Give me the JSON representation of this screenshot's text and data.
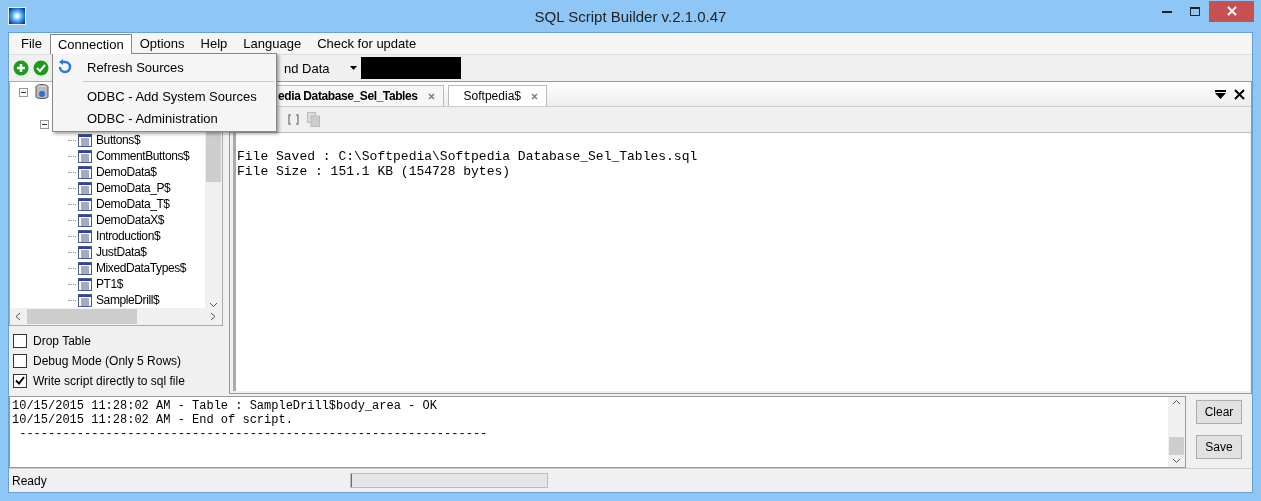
{
  "window": {
    "title": "SQL Script Builder v.2.1.0.47"
  },
  "menu": [
    {
      "label": "File",
      "selected": false
    },
    {
      "label": "Connection",
      "selected": true
    },
    {
      "label": "Options",
      "selected": false
    },
    {
      "label": "Help",
      "selected": false
    },
    {
      "label": "Language",
      "selected": false
    },
    {
      "label": "Check for update",
      "selected": false
    }
  ],
  "dropdown": [
    {
      "label": "Refresh Sources",
      "kind": "icon"
    },
    {
      "kind": "separator"
    },
    {
      "label": "ODBC - Add System Sources",
      "kind": "plain"
    },
    {
      "label": "ODBC - Administration",
      "kind": "plain"
    }
  ],
  "toolbar": {
    "combo_value": "nd Data"
  },
  "tree": {
    "items": [
      "Buttons$",
      "CommentButtons$",
      "DemoData$",
      "DemoData_P$",
      "DemoData_T$",
      "DemoDataX$",
      "Introduction$",
      "JustData$",
      "MixedDataTypes$",
      "PT1$",
      "SampleDrill$"
    ]
  },
  "options": [
    {
      "label": "Drop Table",
      "checked": false
    },
    {
      "label": "Debug Mode (Only 5 Rows)",
      "checked": false
    },
    {
      "label": "Write script directly to sql file",
      "checked": true
    }
  ],
  "tabs": [
    {
      "label": "edia Database_Sel_Tables",
      "selected": true
    },
    {
      "label": "Softpedia$",
      "selected": false
    }
  ],
  "editor": {
    "lines": [
      "File Saved : C:\\Softpedia\\Softpedia Database_Sel_Tables.sql",
      "File Size : 151.1 KB (154728 bytes)"
    ]
  },
  "log": {
    "lines": [
      "10/15/2015 11:28:02 AM - Table : SampleDrill$body_area - OK",
      "10/15/2015 11:28:02 AM - End of script.",
      " -----------------------------------------------------------------"
    ]
  },
  "log_buttons": [
    "Clear",
    "Save"
  ],
  "status_bar": {
    "text": "Ready",
    "progress": {
      "level": 0
    }
  }
}
